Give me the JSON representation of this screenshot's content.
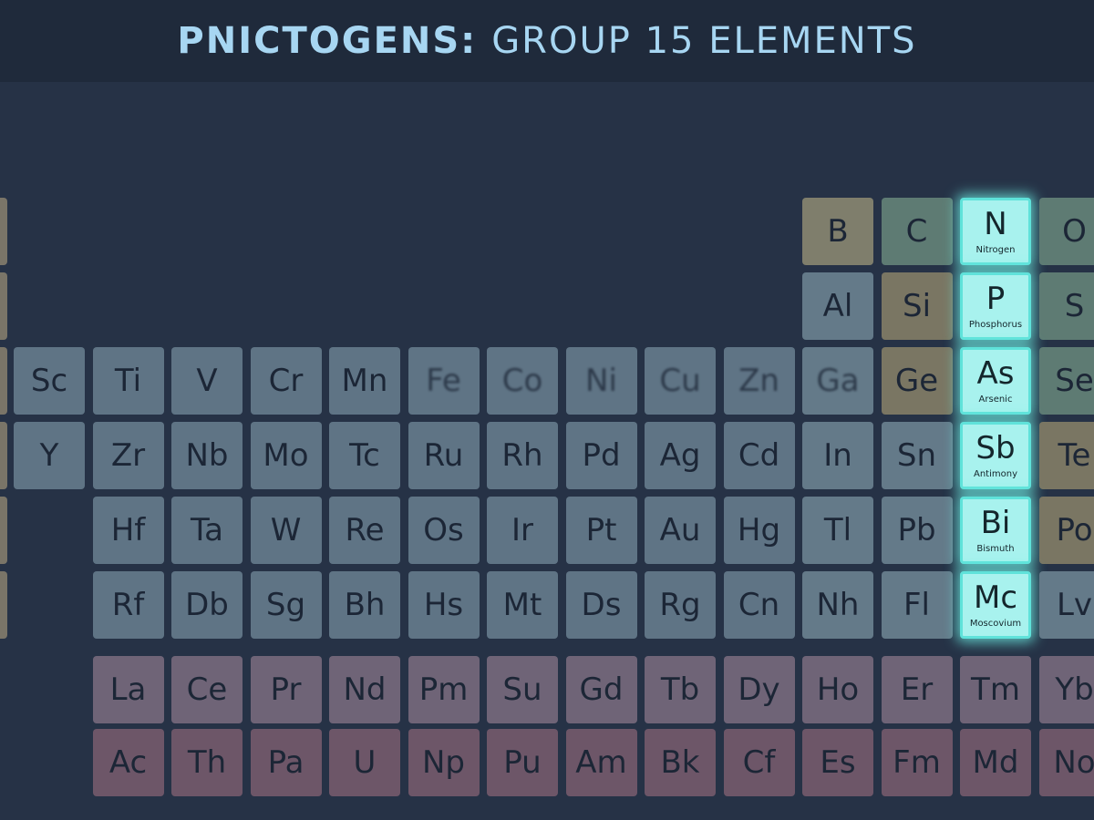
{
  "header": {
    "title_bold": "PNICTOGENS:",
    "title_light": "GROUP 15 ELEMENTS"
  },
  "colors": {
    "background": "#263246",
    "header_bg": "#1f2a3b",
    "title": "#a7d6f2",
    "highlight": "#a8f2ee",
    "highlight_glow": "#5fe2da"
  },
  "table": {
    "edge_tiles": [
      {
        "cls": "t-edge"
      },
      {
        "cls": "t-edge"
      },
      {
        "cls": "t-edge"
      },
      {
        "cls": "t-edge"
      },
      {
        "cls": "t-edge"
      },
      {
        "cls": "t-edge"
      }
    ],
    "rows": [
      [
        {
          "symbol": "B",
          "col": 10,
          "cls": "t-boron"
        },
        {
          "symbol": "C",
          "col": 11,
          "cls": "t-nonmetal"
        },
        {
          "symbol": "N",
          "name": "Nitrogen",
          "col": 12,
          "cls": "t-hl"
        },
        {
          "symbol": "O",
          "col": 13,
          "cls": "t-nonmetal"
        }
      ],
      [
        {
          "symbol": "Al",
          "col": 10,
          "cls": "t-metal"
        },
        {
          "symbol": "Si",
          "col": 11,
          "cls": "t-metalloid"
        },
        {
          "symbol": "P",
          "name": "Phosphorus",
          "col": 12,
          "cls": "t-hl"
        },
        {
          "symbol": "S",
          "col": 13,
          "cls": "t-nonmetal"
        }
      ],
      [
        {
          "symbol": "Sc",
          "col": 0,
          "cls": "t-tm"
        },
        {
          "symbol": "Ti",
          "col": 1,
          "cls": "t-tm"
        },
        {
          "symbol": "V",
          "col": 2,
          "cls": "t-tm"
        },
        {
          "symbol": "Cr",
          "col": 3,
          "cls": "t-tm"
        },
        {
          "symbol": "Mn",
          "col": 4,
          "cls": "t-tm"
        },
        {
          "symbol": "Fe",
          "col": 5,
          "cls": "t-tm t-blur"
        },
        {
          "symbol": "Co",
          "col": 6,
          "cls": "t-tm t-blur"
        },
        {
          "symbol": "Ni",
          "col": 7,
          "cls": "t-tm t-blur"
        },
        {
          "symbol": "Cu",
          "col": 8,
          "cls": "t-tm t-blur"
        },
        {
          "symbol": "Zn",
          "col": 9,
          "cls": "t-tm t-blur"
        },
        {
          "symbol": "Ga",
          "col": 10,
          "cls": "t-metal t-blur"
        },
        {
          "symbol": "Ge",
          "col": 11,
          "cls": "t-metalloid"
        },
        {
          "symbol": "As",
          "name": "Arsenic",
          "col": 12,
          "cls": "t-hl"
        },
        {
          "symbol": "Se",
          "col": 13,
          "cls": "t-nonmetal"
        }
      ],
      [
        {
          "symbol": "Y",
          "col": 0,
          "cls": "t-tm"
        },
        {
          "symbol": "Zr",
          "col": 1,
          "cls": "t-tm"
        },
        {
          "symbol": "Nb",
          "col": 2,
          "cls": "t-tm"
        },
        {
          "symbol": "Mo",
          "col": 3,
          "cls": "t-tm"
        },
        {
          "symbol": "Tc",
          "col": 4,
          "cls": "t-tm"
        },
        {
          "symbol": "Ru",
          "col": 5,
          "cls": "t-tm"
        },
        {
          "symbol": "Rh",
          "col": 6,
          "cls": "t-tm"
        },
        {
          "symbol": "Pd",
          "col": 7,
          "cls": "t-tm"
        },
        {
          "symbol": "Ag",
          "col": 8,
          "cls": "t-tm"
        },
        {
          "symbol": "Cd",
          "col": 9,
          "cls": "t-tm"
        },
        {
          "symbol": "In",
          "col": 10,
          "cls": "t-metal"
        },
        {
          "symbol": "Sn",
          "col": 11,
          "cls": "t-metal"
        },
        {
          "symbol": "Sb",
          "name": "Antimony",
          "col": 12,
          "cls": "t-hl"
        },
        {
          "symbol": "Te",
          "col": 13,
          "cls": "t-metalloid"
        }
      ],
      [
        {
          "symbol": "Hf",
          "col": 1,
          "cls": "t-tm"
        },
        {
          "symbol": "Ta",
          "col": 2,
          "cls": "t-tm"
        },
        {
          "symbol": "W",
          "col": 3,
          "cls": "t-tm"
        },
        {
          "symbol": "Re",
          "col": 4,
          "cls": "t-tm"
        },
        {
          "symbol": "Os",
          "col": 5,
          "cls": "t-tm"
        },
        {
          "symbol": "Ir",
          "col": 6,
          "cls": "t-tm"
        },
        {
          "symbol": "Pt",
          "col": 7,
          "cls": "t-tm"
        },
        {
          "symbol": "Au",
          "col": 8,
          "cls": "t-tm"
        },
        {
          "symbol": "Hg",
          "col": 9,
          "cls": "t-tm"
        },
        {
          "symbol": "Tl",
          "col": 10,
          "cls": "t-metal"
        },
        {
          "symbol": "Pb",
          "col": 11,
          "cls": "t-metal"
        },
        {
          "symbol": "Bi",
          "name": "Bismuth",
          "col": 12,
          "cls": "t-hl"
        },
        {
          "symbol": "Po",
          "col": 13,
          "cls": "t-metalloid"
        }
      ],
      [
        {
          "symbol": "Rf",
          "col": 1,
          "cls": "t-tm"
        },
        {
          "symbol": "Db",
          "col": 2,
          "cls": "t-tm"
        },
        {
          "symbol": "Sg",
          "col": 3,
          "cls": "t-tm"
        },
        {
          "symbol": "Bh",
          "col": 4,
          "cls": "t-tm"
        },
        {
          "symbol": "Hs",
          "col": 5,
          "cls": "t-tm"
        },
        {
          "symbol": "Mt",
          "col": 6,
          "cls": "t-tm"
        },
        {
          "symbol": "Ds",
          "col": 7,
          "cls": "t-tm"
        },
        {
          "symbol": "Rg",
          "col": 8,
          "cls": "t-tm"
        },
        {
          "symbol": "Cn",
          "col": 9,
          "cls": "t-tm"
        },
        {
          "symbol": "Nh",
          "col": 10,
          "cls": "t-metal"
        },
        {
          "symbol": "Fl",
          "col": 11,
          "cls": "t-metal"
        },
        {
          "symbol": "Mc",
          "name": "Moscovium",
          "col": 12,
          "cls": "t-hl"
        },
        {
          "symbol": "Lv",
          "col": 13,
          "cls": "t-metal"
        }
      ],
      [
        {
          "symbol": "La",
          "col": 1,
          "cls": "t-lanth"
        },
        {
          "symbol": "Ce",
          "col": 2,
          "cls": "t-lanth"
        },
        {
          "symbol": "Pr",
          "col": 3,
          "cls": "t-lanth"
        },
        {
          "symbol": "Nd",
          "col": 4,
          "cls": "t-lanth"
        },
        {
          "symbol": "Pm",
          "col": 5,
          "cls": "t-lanth"
        },
        {
          "symbol": "Su",
          "col": 6,
          "cls": "t-lanth"
        },
        {
          "symbol": "Gd",
          "col": 7,
          "cls": "t-lanth"
        },
        {
          "symbol": "Tb",
          "col": 8,
          "cls": "t-lanth"
        },
        {
          "symbol": "Dy",
          "col": 9,
          "cls": "t-lanth"
        },
        {
          "symbol": "Ho",
          "col": 10,
          "cls": "t-lanth"
        },
        {
          "symbol": "Er",
          "col": 11,
          "cls": "t-lanth"
        },
        {
          "symbol": "Tm",
          "col": 12,
          "cls": "t-lanth"
        },
        {
          "symbol": "Yb",
          "col": 13,
          "cls": "t-lanth"
        }
      ],
      [
        {
          "symbol": "Ac",
          "col": 1,
          "cls": "t-act"
        },
        {
          "symbol": "Th",
          "col": 2,
          "cls": "t-act"
        },
        {
          "symbol": "Pa",
          "col": 3,
          "cls": "t-act"
        },
        {
          "symbol": "U",
          "col": 4,
          "cls": "t-act"
        },
        {
          "symbol": "Np",
          "col": 5,
          "cls": "t-act"
        },
        {
          "symbol": "Pu",
          "col": 6,
          "cls": "t-act"
        },
        {
          "symbol": "Am",
          "col": 7,
          "cls": "t-act"
        },
        {
          "symbol": "Bk",
          "col": 8,
          "cls": "t-act"
        },
        {
          "symbol": "Cf",
          "col": 9,
          "cls": "t-act"
        },
        {
          "symbol": "Es",
          "col": 10,
          "cls": "t-act"
        },
        {
          "symbol": "Fm",
          "col": 11,
          "cls": "t-act"
        },
        {
          "symbol": "Md",
          "col": 12,
          "cls": "t-act"
        },
        {
          "symbol": "No",
          "col": 13,
          "cls": "t-act"
        }
      ]
    ]
  }
}
